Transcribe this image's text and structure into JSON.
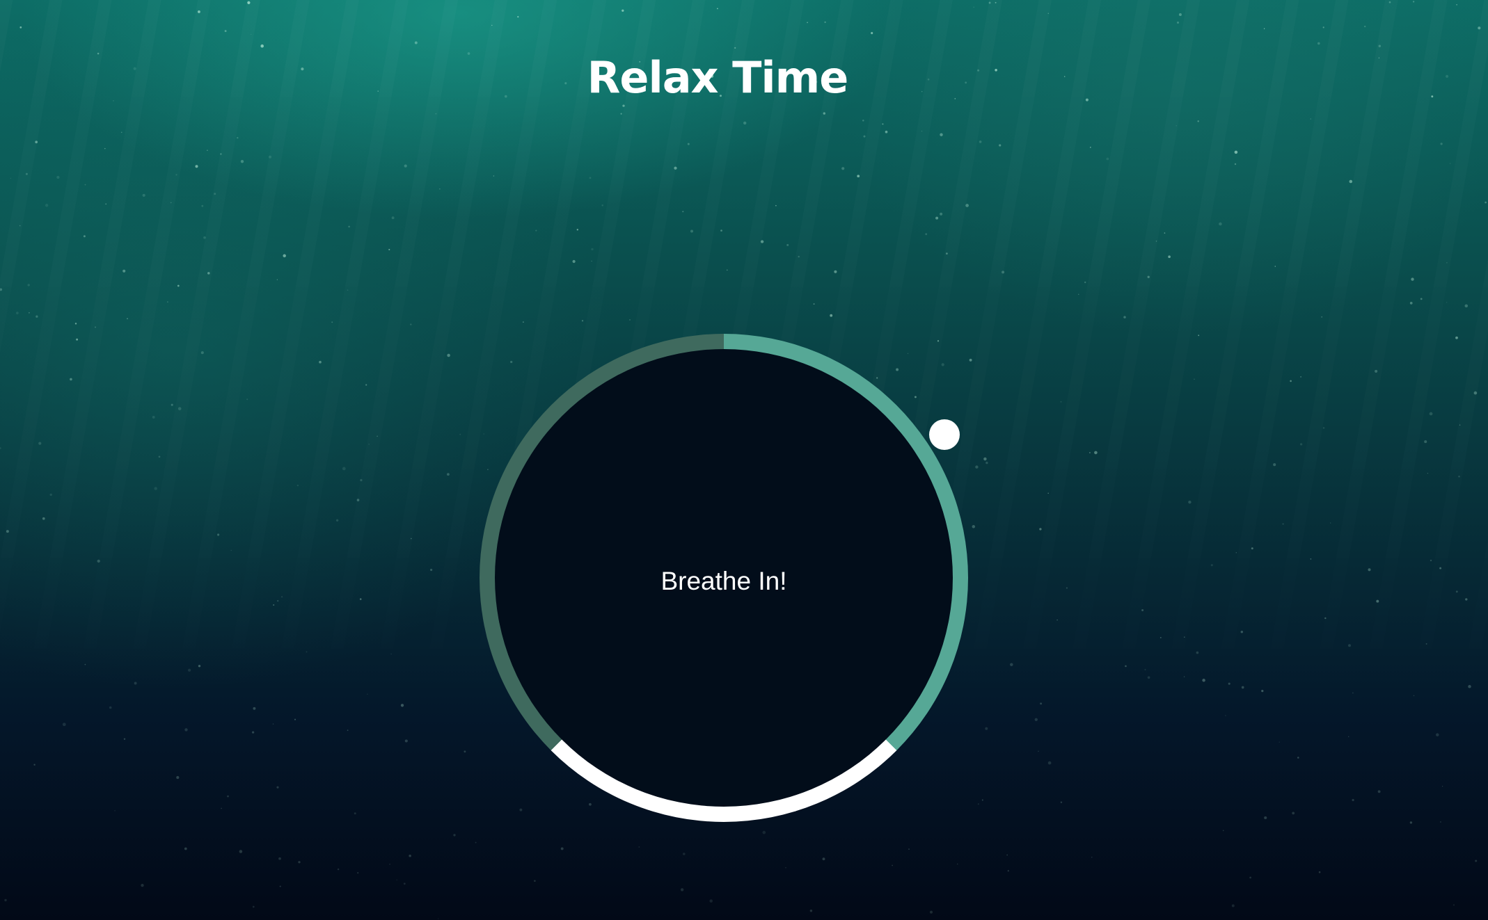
{
  "app": {
    "title": "Relax Time"
  },
  "breathing_widget": {
    "status_text": "Breathe In!",
    "colors": {
      "inhale_segment": "#56a896",
      "hold_segment": "#ffffff",
      "exhale_segment": "#3f6a5e",
      "inner_circle": "#020d1a",
      "pointer": "#ffffff"
    }
  },
  "background": {
    "description_colors": [
      "#0d6d66",
      "#07313a",
      "#020917"
    ]
  }
}
